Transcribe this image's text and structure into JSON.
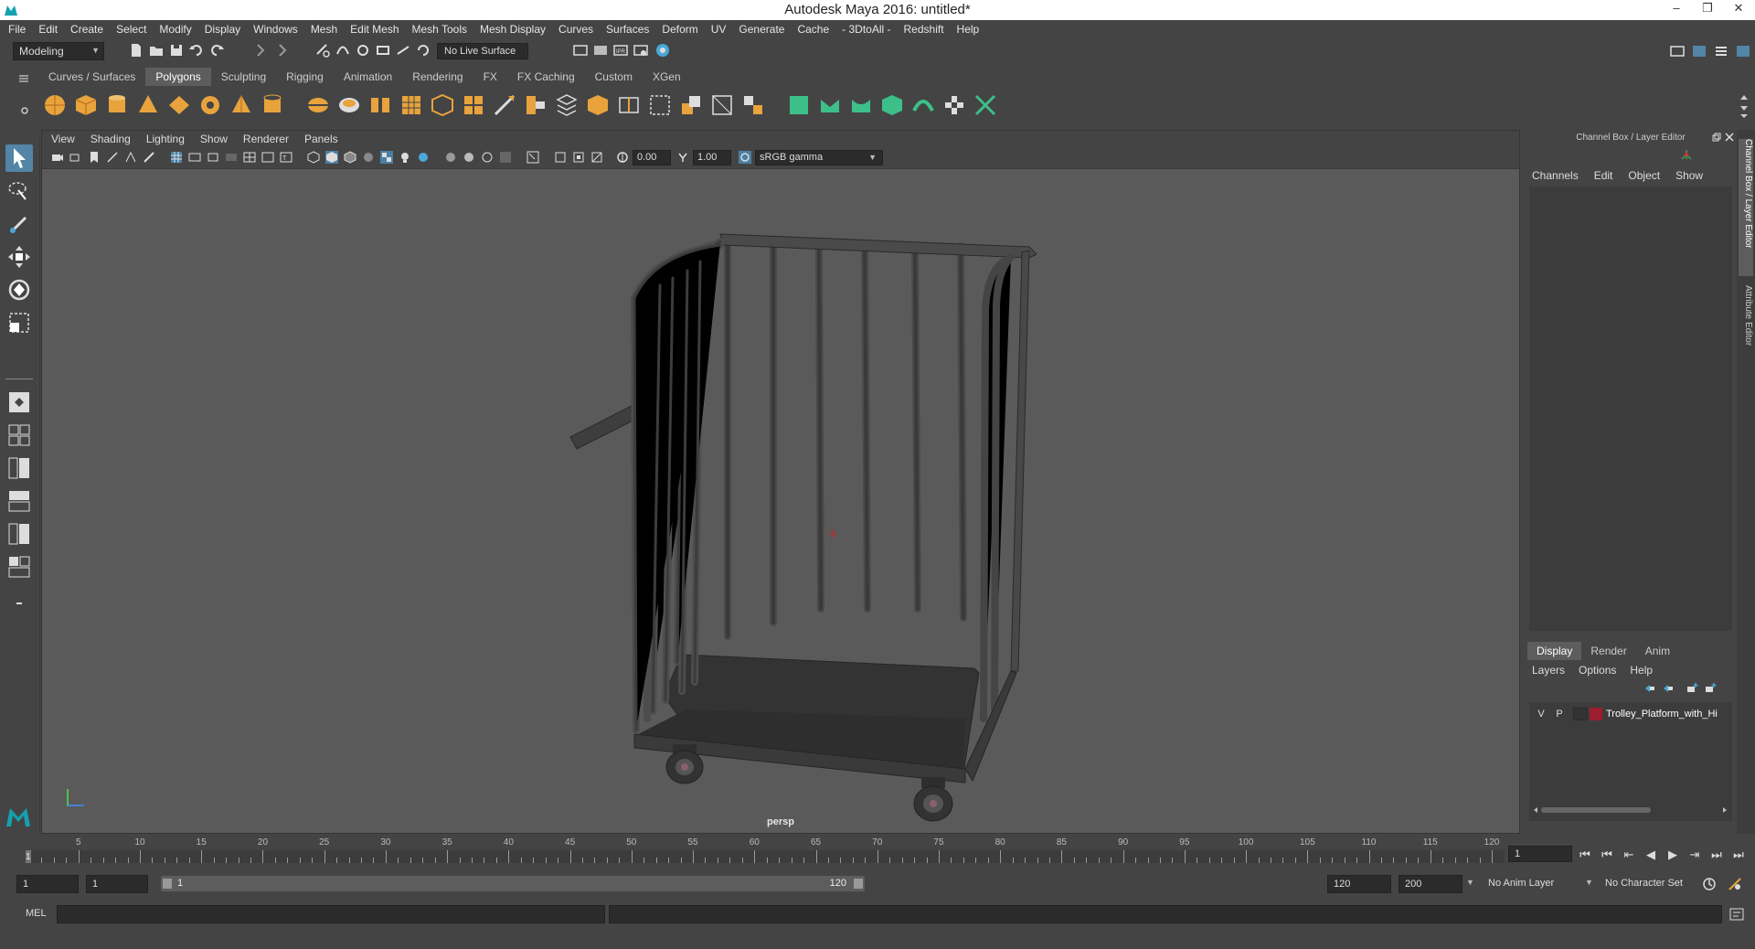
{
  "window": {
    "title": "Autodesk Maya 2016: untitled*",
    "buttons": [
      "‒",
      "❐",
      "✕"
    ]
  },
  "menubar": [
    "File",
    "Edit",
    "Create",
    "Select",
    "Modify",
    "Display",
    "Windows",
    "Mesh",
    "Edit Mesh",
    "Mesh Tools",
    "Mesh Display",
    "Curves",
    "Surfaces",
    "Deform",
    "UV",
    "Generate",
    "Cache",
    "- 3DtoAll -",
    "Redshift",
    "Help"
  ],
  "statusline": {
    "menu_set": "Modeling",
    "live_surface": "No Live Surface"
  },
  "shelf": {
    "tabs": [
      "Curves / Surfaces",
      "Polygons",
      "Sculpting",
      "Rigging",
      "Animation",
      "Rendering",
      "FX",
      "FX Caching",
      "Custom",
      "XGen"
    ],
    "active_tab": "Polygons"
  },
  "viewport": {
    "menu": [
      "View",
      "Shading",
      "Lighting",
      "Show",
      "Renderer",
      "Panels"
    ],
    "exposure": "0.00",
    "gamma": "1.00",
    "color_space": "sRGB gamma",
    "camera_label": "persp"
  },
  "channelbox": {
    "title": "Channel Box / Layer Editor",
    "menu": [
      "Channels",
      "Edit",
      "Object",
      "Show"
    ],
    "side_tabs": [
      "Channel Box / Layer Editor",
      "Attribute Editor"
    ]
  },
  "layer_editor": {
    "tabs": [
      "Display",
      "Render",
      "Anim"
    ],
    "active_tab": "Display",
    "menu": [
      "Layers",
      "Options",
      "Help"
    ],
    "layer": {
      "visible": "V",
      "playback": "P",
      "name": "Trolley_Platform_with_Hi",
      "color": "#9b1d2e"
    }
  },
  "timeline": {
    "ticks": [
      "5",
      "10",
      "15",
      "20",
      "25",
      "30",
      "35",
      "40",
      "45",
      "50",
      "55",
      "60",
      "65",
      "70",
      "75",
      "80",
      "85",
      "90",
      "95",
      "100",
      "105",
      "110",
      "115",
      "120"
    ],
    "start_label": "1",
    "current_frame": "1",
    "playback_buttons": [
      "⏮",
      "⏮",
      "⇤",
      "◀",
      "▶",
      "⇥",
      "⏭",
      "⏭"
    ]
  },
  "range": {
    "start": "1",
    "anim_start": "1",
    "range_start": "1",
    "range_end": "120",
    "end": "120",
    "anim_end": "200",
    "anim_layer": "No Anim Layer",
    "character_set": "No Character Set"
  },
  "cmdline": {
    "label": "MEL"
  },
  "colors": {
    "accent": "#5285a6",
    "shelf_orange": "#e8a33d",
    "shelf_green": "#3dbf8a"
  }
}
